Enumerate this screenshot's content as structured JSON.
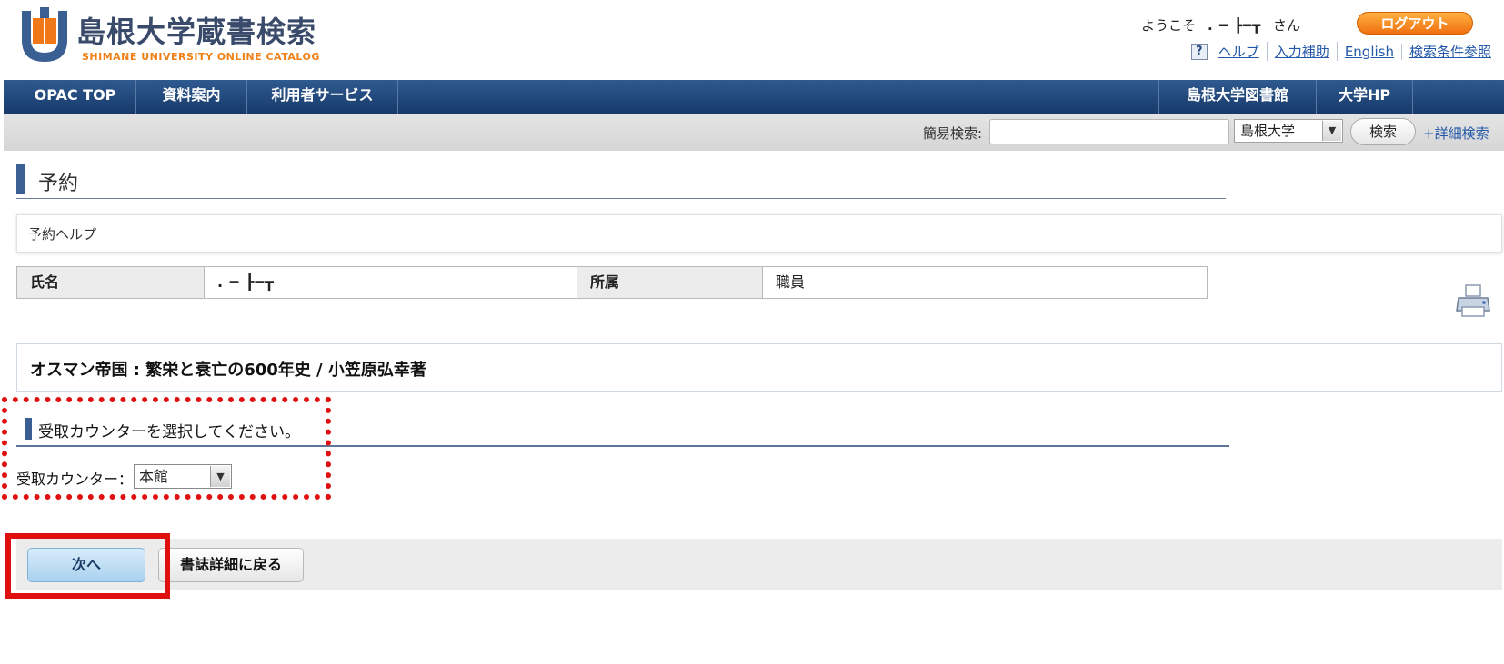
{
  "header": {
    "logo_title": "島根大学蔵書検索",
    "logo_subtitle": "SHIMANE UNIVERSITY ONLINE CATALOG",
    "welcome_prefix": "ようこそ",
    "user_name": ". ━ ┣━┳",
    "welcome_suffix": "さん",
    "logout_label": "ログアウト",
    "links": [
      "ヘルプ",
      "入力補助",
      "English",
      "検索条件参照"
    ]
  },
  "nav": {
    "left": [
      "OPAC TOP",
      "資料案内",
      "利用者サービス"
    ],
    "right": [
      "島根大学図書館",
      "大学HP"
    ]
  },
  "search": {
    "label": "簡易検索:",
    "input_value": "",
    "scope_selected": "島根大学",
    "button_label": "検索",
    "advanced_label": "+詳細検索"
  },
  "page": {
    "title": "予約",
    "help_link": "予約ヘルプ"
  },
  "user_info": {
    "name_header": "氏名",
    "name_value": ". ━ ┣━┳",
    "affiliation_header": "所属",
    "affiliation_value": "職員"
  },
  "book": {
    "title": "オスマン帝国 : 繁栄と衰亡の600年史 / 小笠原弘幸著"
  },
  "counter": {
    "section_title": "受取カウンターを選択してください。",
    "label": "受取カウンター：",
    "selected": "本館"
  },
  "actions": {
    "next_label": "次へ",
    "back_label": "書誌詳細に戻る"
  },
  "colors": {
    "nav_blue": "#1f4678",
    "accent_orange": "#f07818",
    "highlight_red": "#e01010"
  }
}
